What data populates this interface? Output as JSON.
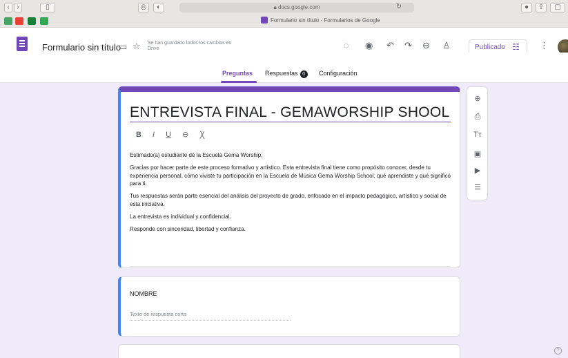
{
  "browser": {
    "url": "docs.google.com",
    "tab_title": "Formulario sin título - Formularios de Google"
  },
  "header": {
    "doc_title": "Formulario sin título",
    "saved_status": "Se han guardado todos los cambios en Drive",
    "publish_label": "Publicado",
    "icons": [
      "palette-icon",
      "preview-icon",
      "undo-icon",
      "redo-icon",
      "link-icon",
      "add-collaborator-icon",
      "more-icon"
    ]
  },
  "tabs": {
    "questions": "Preguntas",
    "responses": "Respuestas",
    "responses_count": "0",
    "settings": "Configuración"
  },
  "form": {
    "title": "ENTREVISTA FINAL - GEMAWORSHIP SHOOL",
    "format": {
      "bold": "B",
      "italic": "I",
      "underline": "U"
    },
    "description": {
      "p1": "Estimado(a) estudiante de la Escuela Gema Worship,",
      "p2": "Gracias por hacer parte de este proceso formativo y artístico. Esta entrevista final tiene como propósito conocer, desde tu experiencia personal, cómo viviste tu participación en la Escuela de Música Gema Worship School, qué aprendiste y qué significó para ti.",
      "p3": "Tus respuestas serán parte esencial del análisis del proyecto de grado, enfocado en el impacto pedagógico, artístico y social de esta iniciativa.",
      "p4": "La entrevista es individual y confidencial.",
      "p5": "Responde con sinceridad, libertad y confianza."
    }
  },
  "question1": {
    "title": "NOMBRE",
    "placeholder": "Texto de respuesta corta"
  },
  "toolbar": {
    "text_label": "Tт"
  },
  "colors": {
    "accent": "#7248b9",
    "active_border": "#4285f4",
    "background": "#f0ebf8"
  }
}
